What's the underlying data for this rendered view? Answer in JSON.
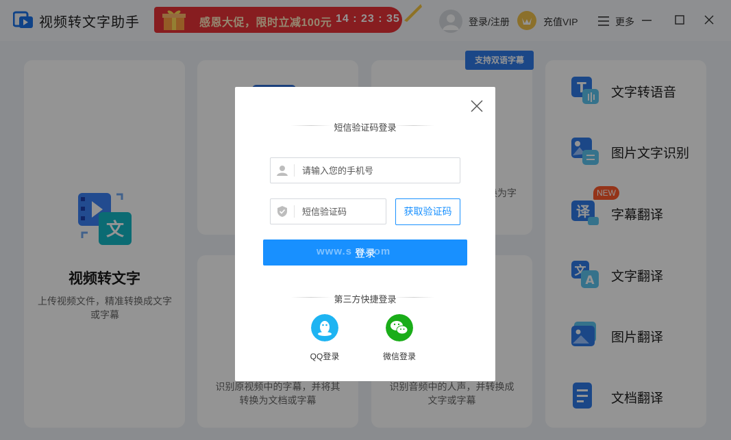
{
  "app": {
    "title": "视频转文字助手"
  },
  "promo": {
    "text": "感恩大促，限时立减100元",
    "timer": "14 : 23 : 35"
  },
  "header": {
    "login_register": "登录/注册",
    "vip": "充值VIP",
    "more": "更多"
  },
  "cards": {
    "video_to_text": {
      "title": "视频转文字",
      "desc": "上传视频文件，精准转换成文字或字幕"
    },
    "subtitle_extract": {
      "desc_line1": "识别原视频中的字幕，并将其",
      "desc_line2": "转换为文档或字幕"
    },
    "audio_to_text": {
      "partial_desc_line1": "换为字",
      "partial_desc_line2": "。",
      "desc_line1": "识别音频中的人声，并转换成",
      "desc_line2": "文字或字幕"
    },
    "bilingual_badge": "支持双语字幕"
  },
  "sidebar": {
    "items": [
      {
        "label": "文字转语音",
        "icon": "text-to-speech-icon"
      },
      {
        "label": "图片文字识别",
        "icon": "image-ocr-icon"
      },
      {
        "label": "字幕翻译",
        "icon": "subtitle-translate-icon",
        "badge": "NEW"
      },
      {
        "label": "文字翻译",
        "icon": "text-translate-icon"
      },
      {
        "label": "图片翻译",
        "icon": "image-translate-icon"
      },
      {
        "label": "文档翻译",
        "icon": "document-translate-icon"
      }
    ]
  },
  "dialog": {
    "heading": "短信验证码登录",
    "phone_placeholder": "请输入您的手机号",
    "code_placeholder": "短信验证码",
    "get_code": "获取验证码",
    "login": "登录",
    "watermark": "www.s     w.com",
    "third_party_heading": "第三方快捷登录",
    "qq_label": "QQ登录",
    "wechat_label": "微信登录"
  },
  "colors": {
    "primary": "#1890ff",
    "promo": "#e93338",
    "overlay": "rgba(0,0,0,0.42)"
  }
}
